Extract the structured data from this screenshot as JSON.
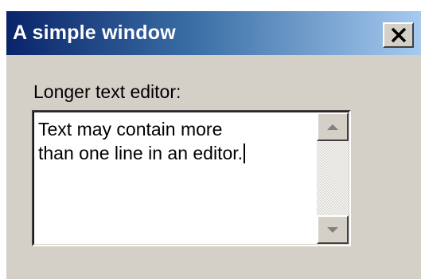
{
  "window": {
    "title": "A simple window",
    "close_icon": "close-x-icon"
  },
  "editor": {
    "label": "Longer text editor:",
    "value": "Text may contain more\nthan one line in an editor."
  },
  "scrollbar": {
    "up_icon": "scroll-up-arrow-icon",
    "down_icon": "scroll-down-arrow-icon"
  },
  "colors": {
    "titlebar_start": "#0a246a",
    "titlebar_end": "#a6caf0",
    "window_bg": "#d4d0c8",
    "disabled_arrow": "#808080"
  }
}
